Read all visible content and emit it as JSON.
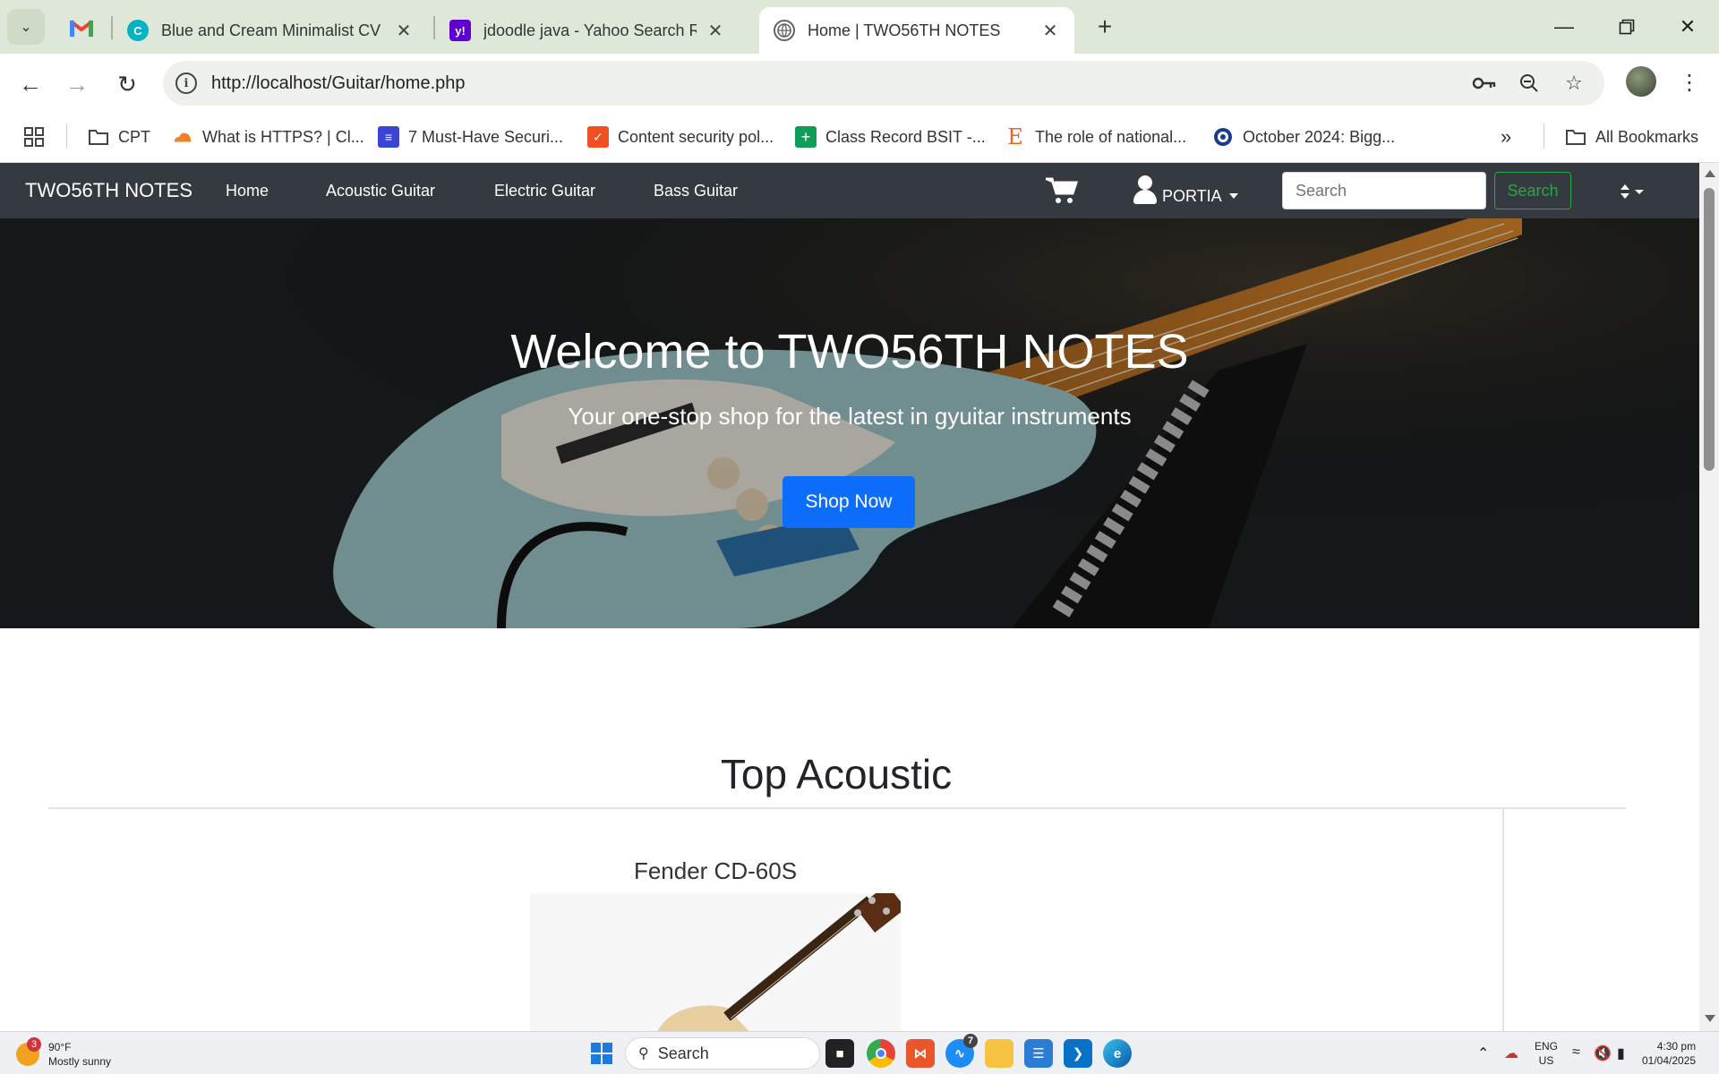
{
  "browser": {
    "tabs": [
      {
        "title": "Blue and Cream Minimalist CV Resume",
        "favicon": "canva-icon",
        "color": "#00c4cc"
      },
      {
        "title": "jdoodle java - Yahoo Search Results",
        "favicon": "yahoo-icon",
        "color": "#6001d2"
      },
      {
        "title": "Home | TWO56TH NOTES",
        "favicon": "globe-icon",
        "color": "#5f6368",
        "active": true
      }
    ],
    "url": "http://localhost/Guitar/home.php",
    "bookmarks": [
      {
        "label": "CPT",
        "icon": "folder-icon"
      },
      {
        "label": "What is HTTPS? | Cl...",
        "icon": "cloudflare-icon",
        "color": "#f48120"
      },
      {
        "label": "7 Must-Have Securi...",
        "icon": "layers-icon",
        "color": "#3a44d6"
      },
      {
        "label": "Content security pol...",
        "icon": "shield-icon",
        "color": "#f04e23"
      },
      {
        "label": "Class Record BSIT -...",
        "icon": "sheets-icon",
        "color": "#0f9d58"
      },
      {
        "label": "The role of national...",
        "icon": "etsy-icon",
        "color": "#f1641e"
      },
      {
        "label": "October 2024: Bigg...",
        "icon": "circle-logo-icon",
        "color": "#1a3a8a"
      }
    ],
    "all_bookmarks_label": "All Bookmarks"
  },
  "site": {
    "brand": "TWO56TH NOTES",
    "nav_links": [
      "Home",
      "Acoustic Guitar",
      "Electric Guitar",
      "Bass Guitar"
    ],
    "user_name": "PORTIA",
    "search_placeholder": "Search",
    "search_button": "Search",
    "hero": {
      "title": "Welcome to TWO56TH NOTES",
      "subtitle": "Your one-stop shop for the latest in gyuitar instruments",
      "button": "Shop Now"
    },
    "section_title": "Top Acoustic",
    "product_name": "Fender CD-60S"
  },
  "taskbar": {
    "weather_temp": "90°F",
    "weather_desc": "Mostly sunny",
    "weather_badge": "3",
    "search_label": "Search",
    "messenger_badge": "7",
    "lang_top": "ENG",
    "lang_bottom": "US",
    "time": "4:30 pm",
    "date": "01/04/2025"
  },
  "colors": {
    "site_nav_bg": "#343a40",
    "primary": "#0d6efd",
    "success": "#28a745"
  }
}
